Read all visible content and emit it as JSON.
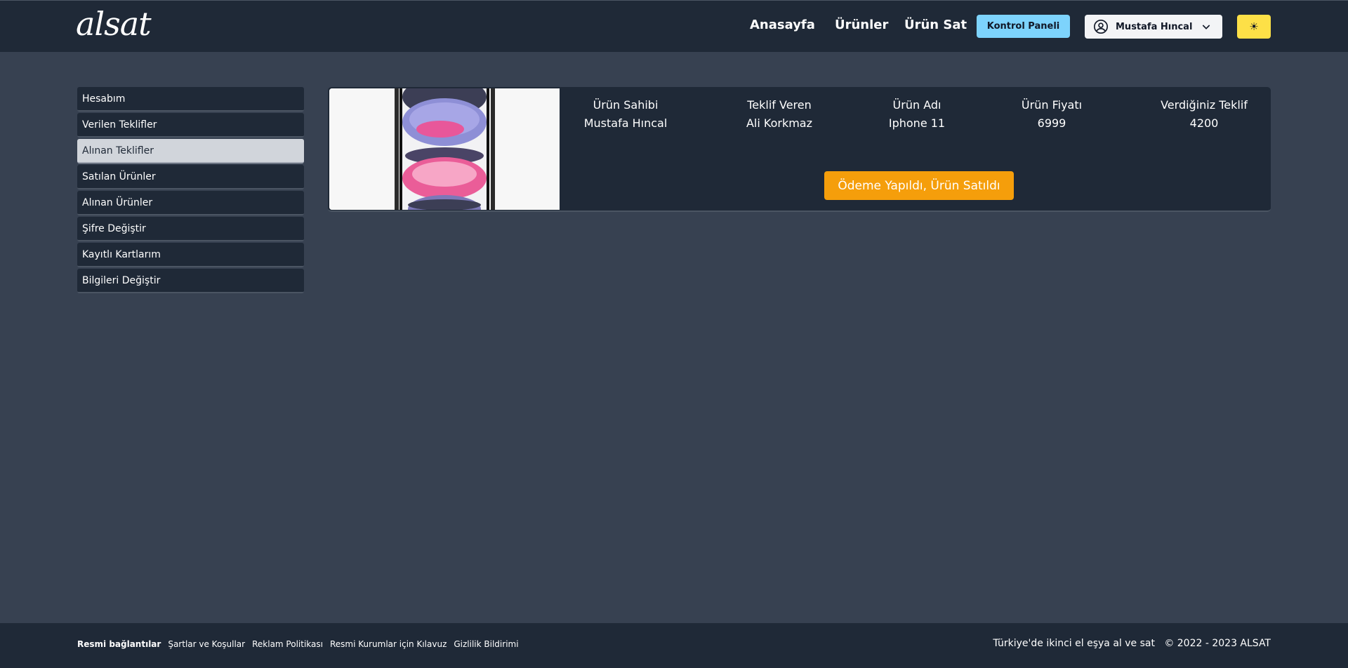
{
  "header": {
    "logo": "alsat",
    "nav": {
      "home": "Anasayfa",
      "products": "Ürünler",
      "sell": "Ürün Sat"
    },
    "control_panel": "Kontrol Paneli",
    "user_name": "Mustafa Hıncal",
    "theme_icon": "sun-icon",
    "theme_glyph": "☀",
    "colors": {
      "control_panel": "#7dd3fc",
      "theme_toggle": "#fde047"
    }
  },
  "sidebar": {
    "items": [
      {
        "label": "Hesabım"
      },
      {
        "label": "Verilen Teklifler"
      },
      {
        "label": "Alınan Teklifler",
        "active": true
      },
      {
        "label": "Satılan Ürünler"
      },
      {
        "label": "Alınan Ürünler"
      },
      {
        "label": "Şifre Değiştir"
      },
      {
        "label": "Kayıtlı Kartlarım"
      },
      {
        "label": "Bilgileri Değiştir"
      }
    ]
  },
  "offer": {
    "columns": {
      "owner_label": "Ürün Sahibi",
      "offerer_label": "Teklif Veren",
      "name_label": "Ürün Adı",
      "price_label": "Ürün Fiyatı",
      "offer_label": "Verdiğiniz Teklif"
    },
    "values": {
      "owner": "Mustafa Hıncal",
      "offerer": "Ali Korkmaz",
      "name": "Iphone 11",
      "price": "6999",
      "offer": "4200"
    },
    "status_button": "Ödeme Yapıldı, Ürün Satıldı",
    "status_color": "#f59e0b"
  },
  "footer": {
    "links_title": "Resmi bağlantılar",
    "links": [
      "Şartlar ve Koşullar",
      "Reklam Politikası",
      "Resmi Kurumlar için Kılavuz",
      "Gizlilik Bildirimi"
    ],
    "tagline": "Türkiye'de ikinci el eşya al ve sat",
    "copyright": "© 2022 - 2023 ALSAT"
  }
}
